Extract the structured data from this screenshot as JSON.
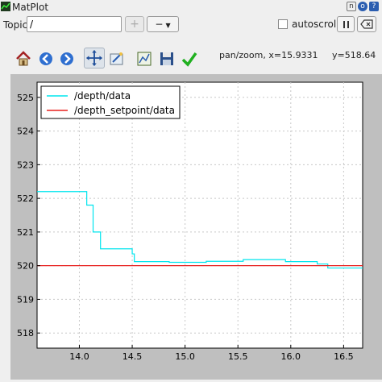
{
  "window": {
    "title": "MatPlot"
  },
  "title_buttons": [
    "n",
    "o",
    "?"
  ],
  "topic": {
    "label": "Topic",
    "value": "/"
  },
  "controls": {
    "add_label": "+",
    "remove_label": "−",
    "autoscroll_label": "autoscroll",
    "autoscroll_checked": false
  },
  "toolbar": {
    "coords_text": "pan/zoom, x=15.9331     y=518.64"
  },
  "chart_data": {
    "type": "line",
    "xlim": [
      13.6,
      16.68
    ],
    "ylim": [
      517.55,
      525.45
    ],
    "xticks": [
      "14.0",
      "14.5",
      "15.0",
      "15.5",
      "16.0",
      "16.5"
    ],
    "yticks": [
      "518",
      "519",
      "520",
      "521",
      "522",
      "523",
      "524",
      "525"
    ],
    "grid": true,
    "legend_position": "top-left",
    "series": [
      {
        "name": "/depth/data",
        "color": "#00e5ee",
        "step": true,
        "x": [
          13.6,
          14.05,
          14.07,
          14.1,
          14.13,
          14.18,
          14.2,
          14.48,
          14.5,
          14.52,
          14.85,
          15.2,
          15.55,
          15.95,
          16.25,
          16.35,
          16.68
        ],
        "y": [
          522.2,
          522.2,
          521.8,
          521.8,
          521.0,
          521.0,
          520.5,
          520.5,
          520.35,
          520.12,
          520.1,
          520.13,
          520.18,
          520.12,
          520.05,
          519.93,
          519.93
        ]
      },
      {
        "name": "/depth_setpoint/data",
        "color": "#e8201f",
        "step": false,
        "x": [
          13.6,
          16.68
        ],
        "y": [
          520.0,
          520.0
        ]
      }
    ]
  }
}
